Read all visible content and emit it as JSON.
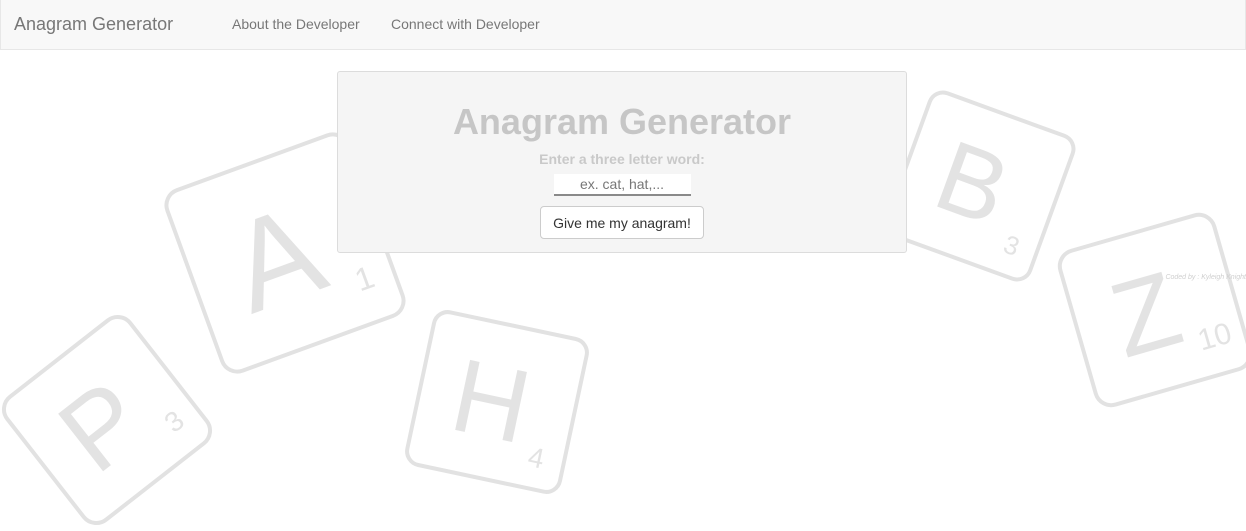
{
  "navbar": {
    "brand": "Anagram Generator",
    "links": [
      {
        "label": "About the Developer"
      },
      {
        "label": "Connect with Developer"
      }
    ]
  },
  "main": {
    "title": "Anagram Generator",
    "prompt": "Enter a three letter word:",
    "input": {
      "placeholder": "ex. cat, hat,...",
      "value": ""
    },
    "submit_label": "Give me my anagram!"
  },
  "background_tiles": [
    {
      "letter": "P",
      "points": "3"
    },
    {
      "letter": "A",
      "points": "1"
    },
    {
      "letter": "H",
      "points": "4"
    },
    {
      "letter": "B",
      "points": "3"
    },
    {
      "letter": "Z",
      "points": "10"
    }
  ],
  "footer": {
    "credit": "Coded by : Kyleigh Knight"
  },
  "colors": {
    "navbar_bg": "#f8f8f8",
    "card_bg": "#f5f5f5",
    "title_text": "#c6c6c6",
    "tile_stroke": "#e2e2e2",
    "tile_letter": "#e3e3e3"
  }
}
